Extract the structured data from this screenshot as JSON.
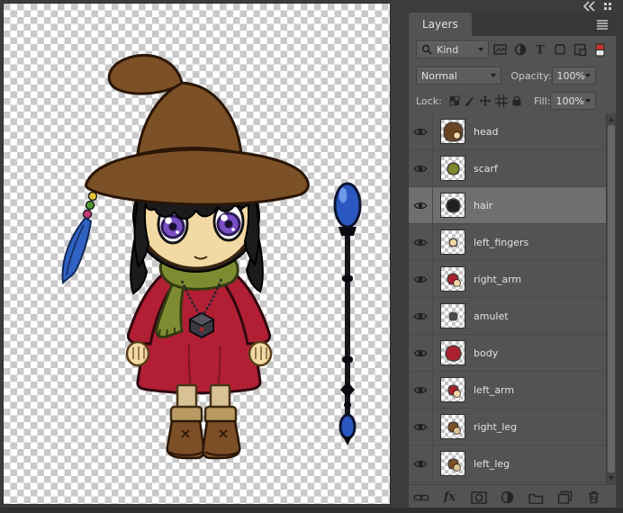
{
  "panel": {
    "tab_label": "Layers",
    "filter": {
      "kind_label": "Kind"
    },
    "blend_mode": "Normal",
    "opacity_label": "Opacity:",
    "opacity_value": "100%",
    "lock_label": "Lock:",
    "fill_label": "Fill:",
    "fill_value": "100%"
  },
  "icons": {
    "type_glyph": "T",
    "fx_glyph": "fx"
  },
  "layers": [
    {
      "name": "head",
      "selected": false,
      "thumb": {
        "colors": [
          "#6b4423",
          "#f0d6a4"
        ],
        "scale": 0.85
      }
    },
    {
      "name": "scarf",
      "selected": false,
      "thumb": {
        "colors": [
          "#7d8a2e"
        ],
        "scale": 0.5
      }
    },
    {
      "name": "hair",
      "selected": true,
      "thumb": {
        "colors": [
          "#22201f"
        ],
        "scale": 0.6
      }
    },
    {
      "name": "left_fingers",
      "selected": false,
      "thumb": {
        "colors": [
          "#f0d6a4"
        ],
        "scale": 0.3
      }
    },
    {
      "name": "right_arm",
      "selected": false,
      "thumb": {
        "colors": [
          "#ab2130",
          "#f0d6a4"
        ],
        "scale": 0.45
      }
    },
    {
      "name": "amulet",
      "selected": false,
      "thumb": {
        "colors": [
          "#4a4a52"
        ],
        "scale": 0.3
      }
    },
    {
      "name": "body",
      "selected": false,
      "thumb": {
        "colors": [
          "#ab2130"
        ],
        "scale": 0.7
      }
    },
    {
      "name": "left_arm",
      "selected": false,
      "thumb": {
        "colors": [
          "#ab2130",
          "#f0d6a4"
        ],
        "scale": 0.4
      }
    },
    {
      "name": "right_leg",
      "selected": false,
      "thumb": {
        "colors": [
          "#7d5026",
          "#d9c194"
        ],
        "scale": 0.4
      }
    },
    {
      "name": "left_leg",
      "selected": false,
      "thumb": {
        "colors": [
          "#7d5026",
          "#d9c194"
        ],
        "scale": 0.4
      }
    }
  ],
  "colors": {
    "panel_bg": "#535353",
    "panel_dark": "#383838",
    "selected_row": "#6f6f6f",
    "dress_red": "#b21f35",
    "scarf_olive": "#7e8c31",
    "hat_brown": "#7c5026",
    "staff_blue": "#2a58c0",
    "eye_purple": "#7a4fc4"
  }
}
